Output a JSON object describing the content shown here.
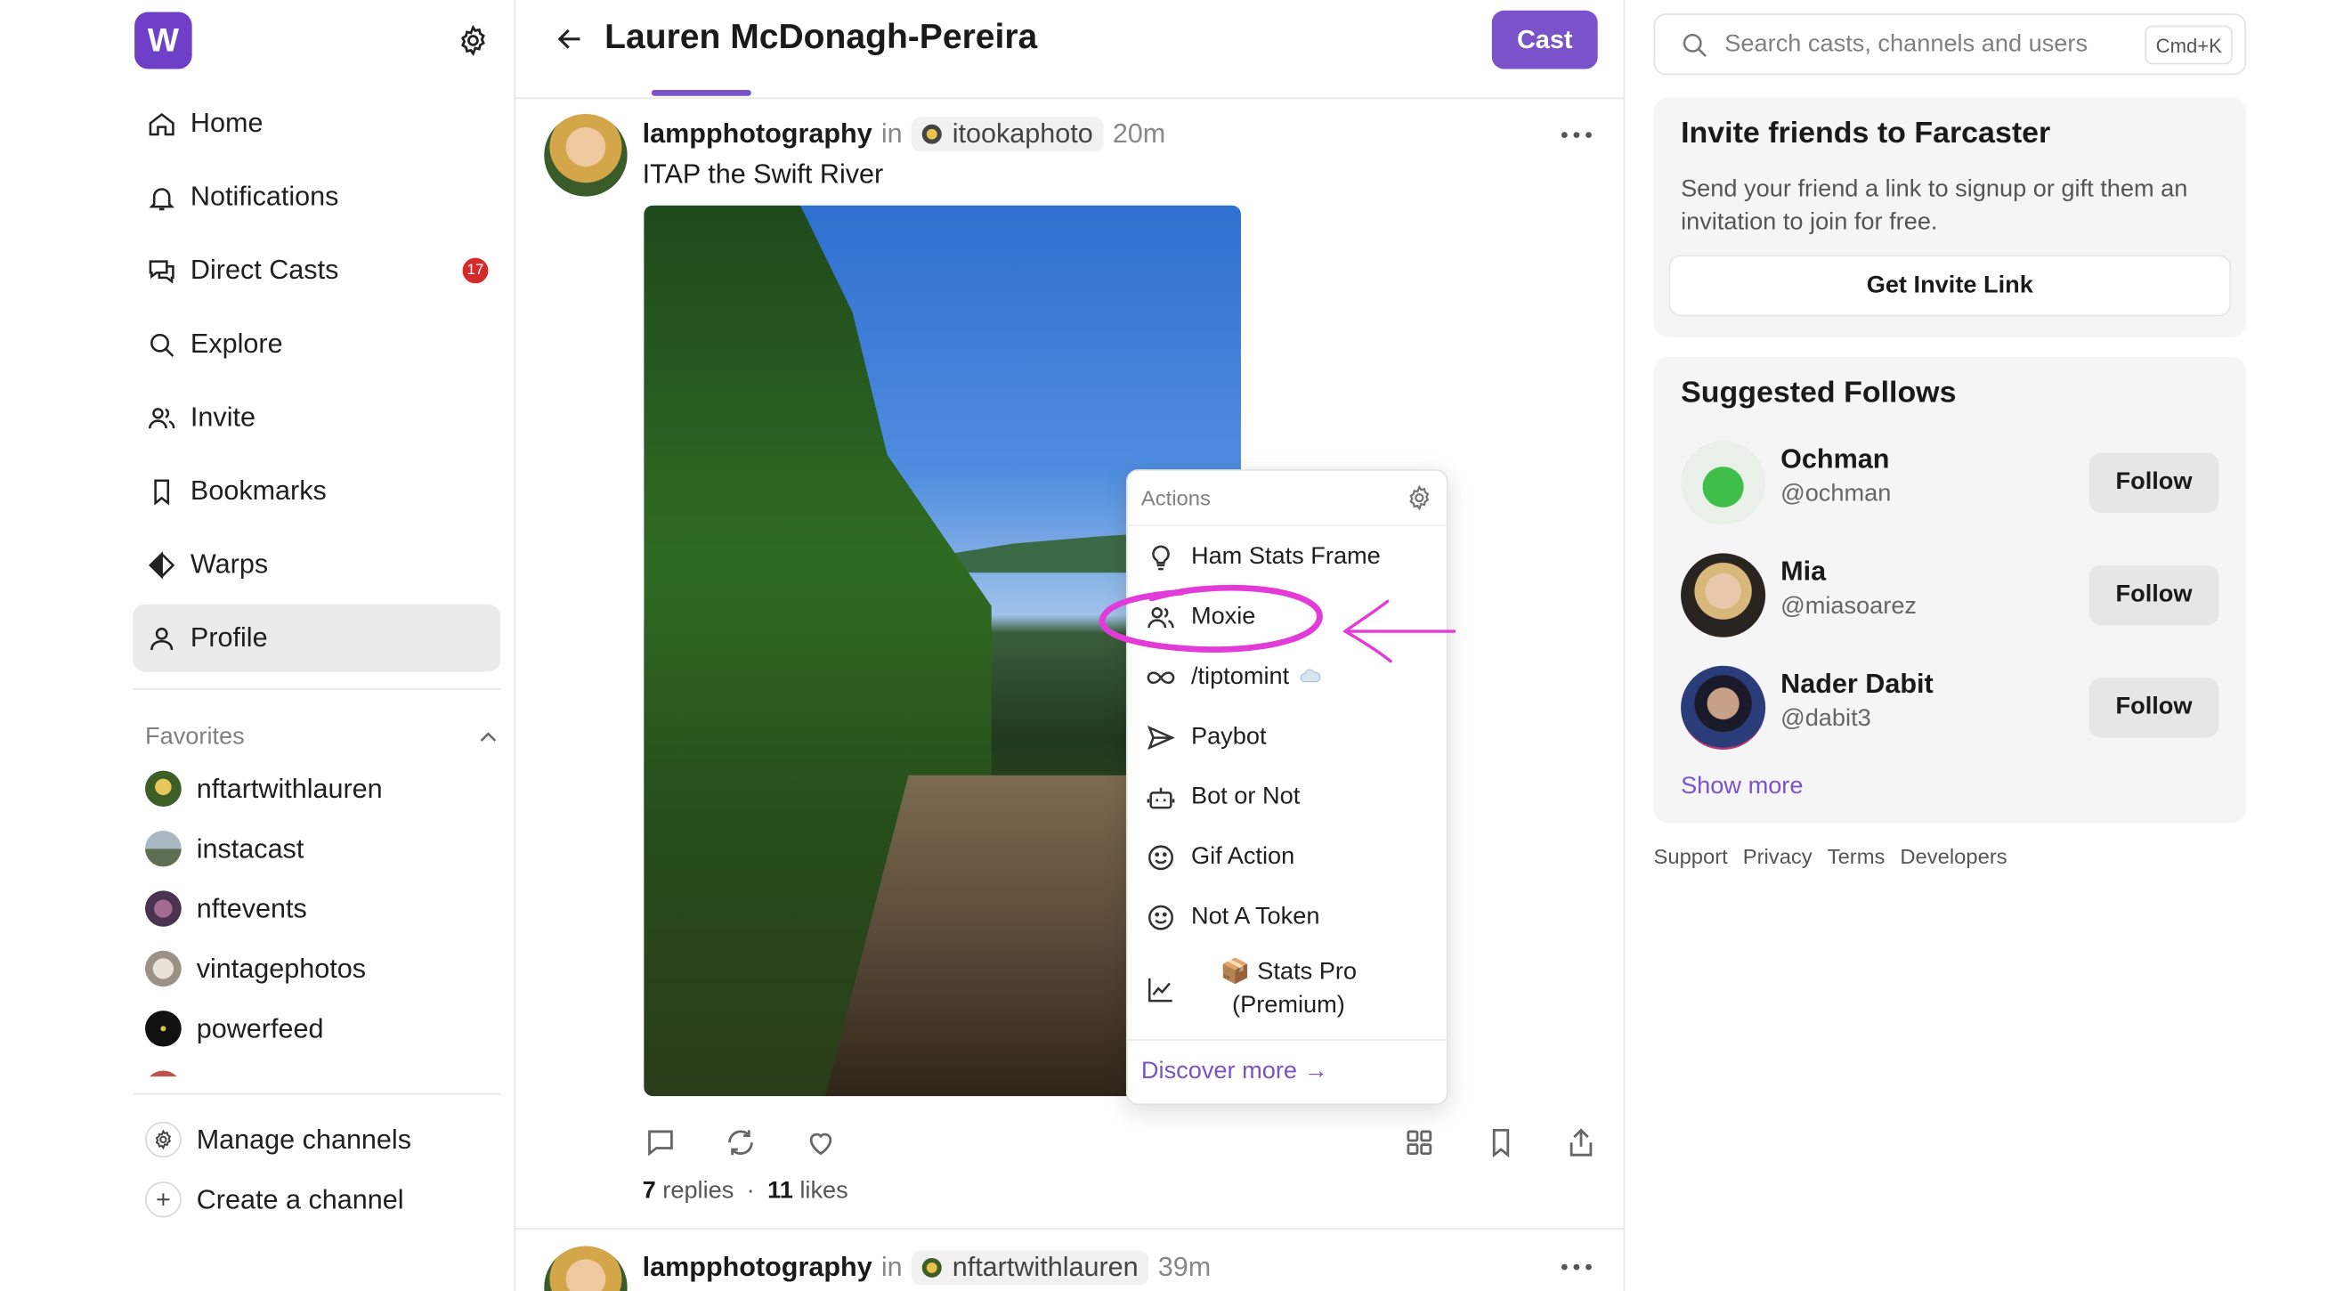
{
  "sidebar": {
    "logo": "W",
    "items": [
      {
        "label": "Home"
      },
      {
        "label": "Notifications"
      },
      {
        "label": "Direct Casts",
        "badge": "17"
      },
      {
        "label": "Explore"
      },
      {
        "label": "Invite"
      },
      {
        "label": "Bookmarks"
      },
      {
        "label": "Warps"
      },
      {
        "label": "Profile"
      }
    ],
    "favorites_label": "Favorites",
    "favorites": [
      {
        "name": "nftartwithlauren",
        "color": "#7a8a3a"
      },
      {
        "name": "instacast",
        "color": "#8a9aa6"
      },
      {
        "name": "nftevents",
        "color": "#6b4a6e"
      },
      {
        "name": "vintagephotos",
        "color": "#c8c0b0"
      },
      {
        "name": "powerfeed",
        "color": "#111111"
      }
    ],
    "manage_channels": "Manage channels",
    "create_channel": "Create a channel"
  },
  "header": {
    "title": "Lauren McDonagh-Pereira",
    "cast_button": "Cast"
  },
  "post": {
    "username": "lampphotography",
    "in": "in",
    "channel": "itookaphoto",
    "time": "20m",
    "text": "ITAP the Swift River",
    "replies_count": "7",
    "replies_label": "replies",
    "separator": "·",
    "likes_count": "11",
    "likes_label": "likes"
  },
  "post2": {
    "username": "lampphotography",
    "in": "in",
    "channel": "nftartwithlauren",
    "time": "39m"
  },
  "actions_menu": {
    "header": "Actions",
    "items": [
      {
        "label": "Ham Stats Frame",
        "icon": "lightbulb-icon"
      },
      {
        "label": "Moxie",
        "icon": "users-icon"
      },
      {
        "label": "/tiptomint",
        "icon": "infinity-icon"
      },
      {
        "label": "Paybot",
        "icon": "send-icon"
      },
      {
        "label": "Bot or Not",
        "icon": "robot-icon"
      },
      {
        "label": "Gif Action",
        "icon": "smile-icon"
      },
      {
        "label": "Not A Token",
        "icon": "smile-icon"
      },
      {
        "label": "📦 Stats Pro (Premium)",
        "icon": "chart-icon"
      }
    ],
    "footer": "Discover more →",
    "highlight_color": "#e23bd8"
  },
  "right": {
    "search_placeholder": "Search casts, channels and users",
    "search_shortcut": "Cmd+K",
    "invite": {
      "title": "Invite friends to Farcaster",
      "text": "Send your friend a link to signup or gift them an invitation to join for free.",
      "button": "Get Invite Link"
    },
    "suggested": {
      "title": "Suggested Follows",
      "users": [
        {
          "name": "Ochman",
          "handle": "@ochman",
          "button": "Follow",
          "color": "#3fbf4a"
        },
        {
          "name": "Mia",
          "handle": "@miasoarez",
          "button": "Follow",
          "color": "#2a2420"
        },
        {
          "name": "Nader Dabit",
          "handle": "@dabit3",
          "button": "Follow",
          "color": "#2a3c7a"
        }
      ],
      "show_more": "Show more"
    },
    "footer_links": [
      "Support",
      "Privacy",
      "Terms",
      "Developers"
    ]
  },
  "colors": {
    "accent": "#7a52c9",
    "badge": "#d42a2a"
  }
}
